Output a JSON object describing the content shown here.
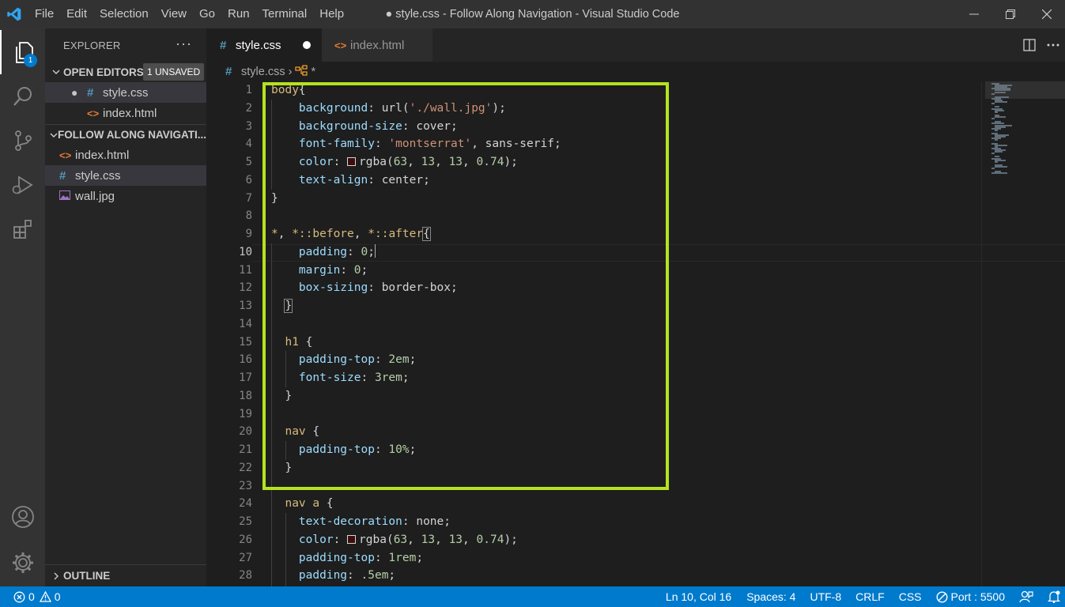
{
  "window": {
    "title": "● style.css - Follow Along Navigation - Visual Studio Code",
    "menu": [
      "File",
      "Edit",
      "Selection",
      "View",
      "Go",
      "Run",
      "Terminal",
      "Help"
    ]
  },
  "activity": {
    "explorer_badge": "1"
  },
  "sidebar": {
    "title": "EXPLORER",
    "more": "···",
    "open_editors": {
      "label": "OPEN EDITORS",
      "badge": "1 UNSAVED",
      "items": [
        {
          "icon": "#",
          "name": "style.css",
          "dirty": true
        },
        {
          "icon": "<>",
          "name": "index.html"
        }
      ]
    },
    "folder": {
      "label": "FOLLOW ALONG NAVIGATI...",
      "items": [
        {
          "icon": "<>",
          "name": "index.html"
        },
        {
          "icon": "#",
          "name": "style.css"
        },
        {
          "icon": "image-icon",
          "name": "wall.jpg"
        }
      ]
    },
    "outline_label": "OUTLINE"
  },
  "tabs": [
    {
      "icon": "#",
      "label": "style.css",
      "active": true,
      "dirty": true
    },
    {
      "icon": "<>",
      "label": "index.html",
      "active": false
    }
  ],
  "breadcrumb": {
    "file_icon": "#",
    "file": "style.css",
    "symbol": "*"
  },
  "editor": {
    "active_line": 10,
    "line_numbers": [
      "1",
      "2",
      "3",
      "4",
      "5",
      "6",
      "7",
      "8",
      "9",
      "10",
      "11",
      "12",
      "13",
      "14",
      "15",
      "16",
      "17",
      "18",
      "19",
      "20",
      "21",
      "22",
      "23",
      "24",
      "25",
      "26",
      "27",
      "28"
    ],
    "highlight_color": "#b5e21f"
  },
  "status": {
    "errors": "0",
    "warnings": "0",
    "position": "Ln 10, Col 16",
    "spaces": "Spaces: 4",
    "encoding": "UTF-8",
    "eol": "CRLF",
    "language": "CSS",
    "port": "Port : 5500"
  },
  "colors": {
    "accent": "#007acc",
    "selector": "#d7ba7d",
    "property": "#9cdcfe",
    "number": "#b5cea8",
    "string": "#ce9178"
  }
}
